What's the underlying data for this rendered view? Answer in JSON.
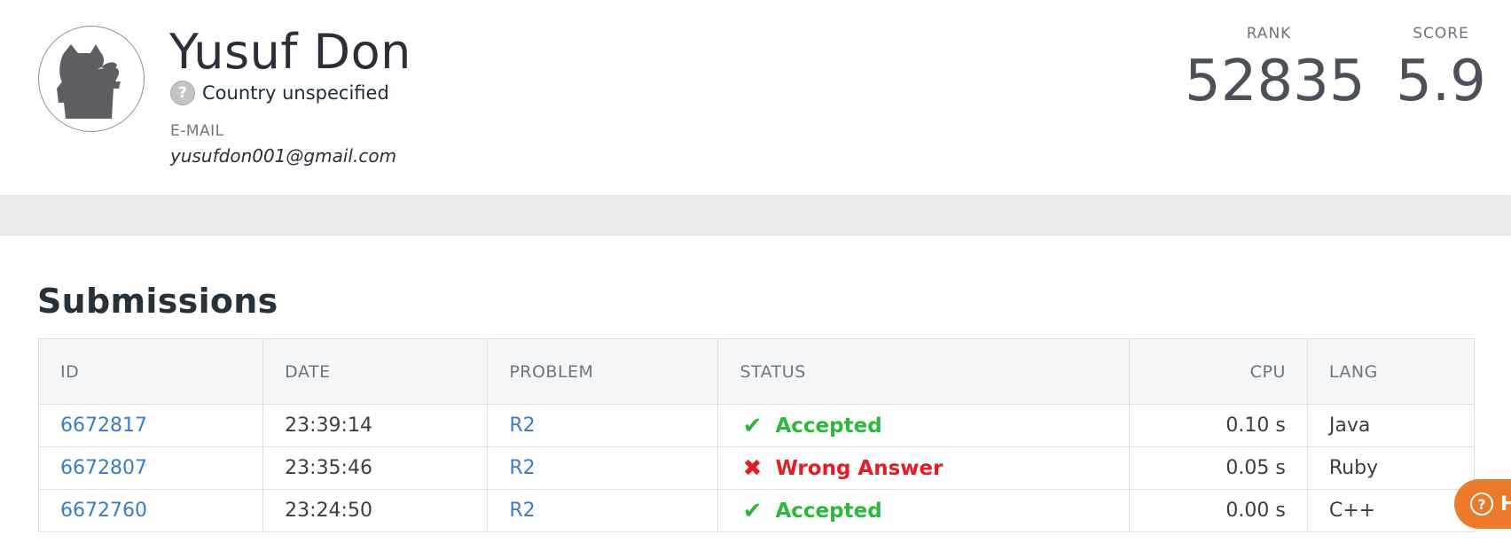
{
  "profile": {
    "name": "Yusuf Don",
    "country_icon": "?",
    "country_label": "Country unspecified",
    "email_heading": "E-MAIL",
    "email": "yusufdon001@gmail.com",
    "rank_label": "RANK",
    "rank_value": "52835",
    "score_label": "SCORE",
    "score_value": "5.9"
  },
  "submissions": {
    "title": "Submissions",
    "columns": {
      "id": "ID",
      "date": "DATE",
      "problem": "PROBLEM",
      "status": "STATUS",
      "cpu": "CPU",
      "lang": "LANG"
    },
    "rows": [
      {
        "id": "6672817",
        "date": "23:39:14",
        "problem": "R2",
        "status_icon": "✔",
        "status": "Accepted",
        "cpu": "0.10 s",
        "lang": "Java"
      },
      {
        "id": "6672807",
        "date": "23:35:46",
        "problem": "R2",
        "status_icon": "✖",
        "status": "Wrong Answer",
        "cpu": "0.05 s",
        "lang": "Ruby"
      },
      {
        "id": "6672760",
        "date": "23:24:50",
        "problem": "R2",
        "status_icon": "✔",
        "status": "Accepted",
        "cpu": "0.00 s",
        "lang": "C++"
      }
    ]
  },
  "help": {
    "icon": "?",
    "label": "He"
  },
  "colors": {
    "accepted": "#2db83d",
    "wrong": "#e51c23",
    "link": "#3a7dc4",
    "help": "#ec7a2a"
  },
  "icons": {
    "avatar": "cat-silhouette-icon",
    "country": "question-circle-icon",
    "accepted": "check-icon",
    "wrong": "cross-icon",
    "help": "help-circle-icon"
  }
}
